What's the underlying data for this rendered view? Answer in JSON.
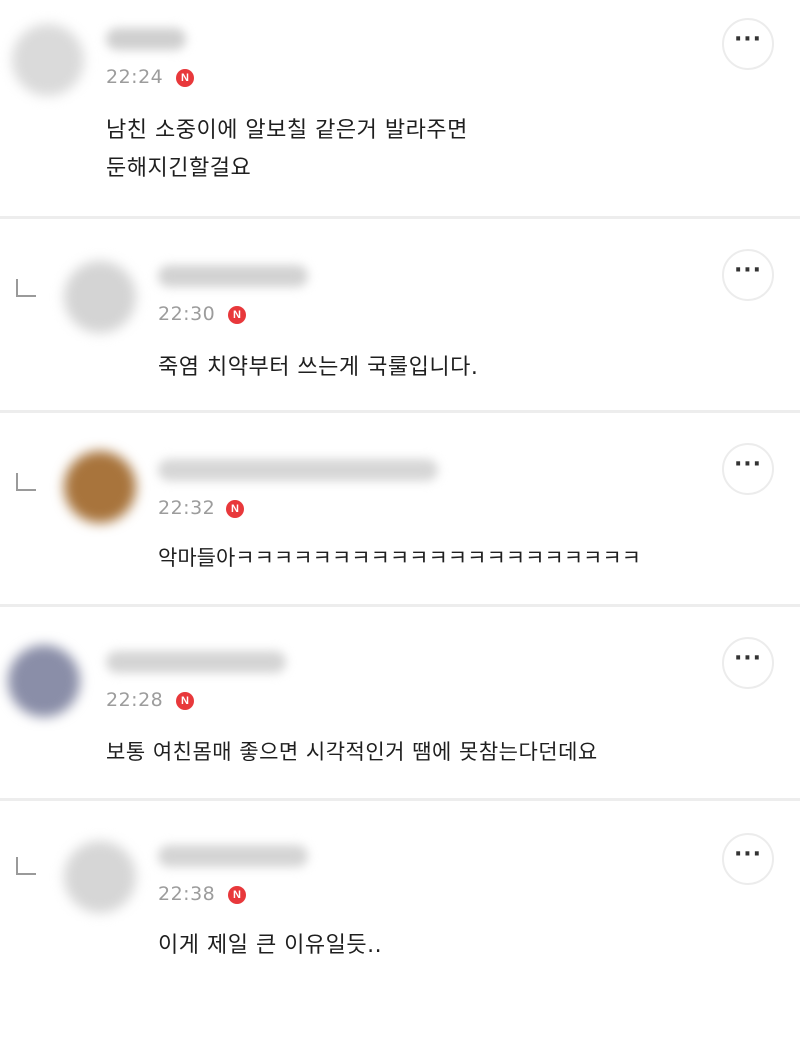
{
  "comments": [
    {
      "time": "22:24",
      "badge": "N",
      "text": "남친 소중이에 알보칠 같은거 발라주면\n둔해지긴할걸요",
      "more_label": "···",
      "avatar_color": "#dadada",
      "is_reply": false
    },
    {
      "time": "22:30",
      "badge": "N",
      "text": "죽염 치약부터 쓰는게 국룰입니다.",
      "more_label": "···",
      "avatar_color": "#d4d4d4",
      "is_reply": true
    },
    {
      "time": "22:32",
      "badge": "N",
      "text": "악마들아ㅋㅋㅋㅋㅋㅋㅋㅋㅋㅋㅋㅋㅋㅋㅋㅋㅋㅋㅋㅋㅋ",
      "more_label": "···",
      "avatar_color": "#a8743c",
      "is_reply": true
    },
    {
      "time": "22:28",
      "badge": "N",
      "text": "보통 여친몸매 좋으면 시각적인거 땜에 못참는다던데요",
      "more_label": "···",
      "avatar_color": "#8a8ea8",
      "is_reply": false
    },
    {
      "time": "22:38",
      "badge": "N",
      "text": "이게 제일 큰 이유일듯..",
      "more_label": "···",
      "avatar_color": "#d6d6d6",
      "is_reply": true
    }
  ],
  "colors": {
    "badge": "#e8383b",
    "time": "#9c9c9c",
    "divider": "#ededed"
  },
  "icons": {
    "reply": "reply-arrow-icon",
    "more": "more-options-icon",
    "new": "new-badge-icon"
  }
}
